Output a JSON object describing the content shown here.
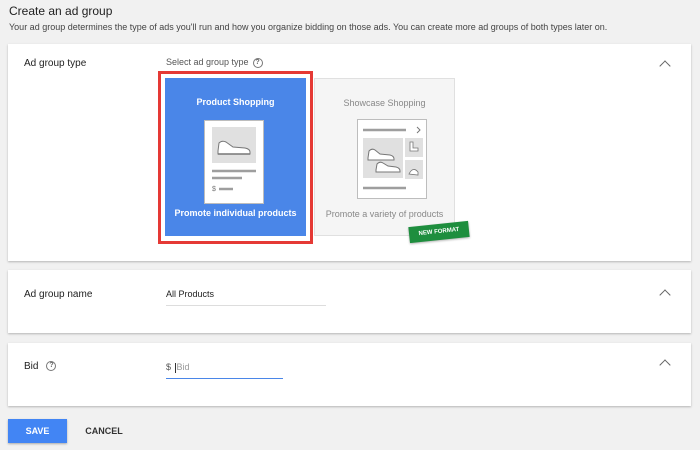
{
  "header": {
    "title": "Create an ad group",
    "subtitle": "Your ad group determines the type of ads you'll run and how you organize bidding on those ads. You can create more ad groups of both types later on."
  },
  "ad_group_type": {
    "label": "Ad group type",
    "select_label": "Select ad group type",
    "options": [
      {
        "title": "Product Shopping",
        "description": "Promote individual products",
        "selected": true
      },
      {
        "title": "Showcase Shopping",
        "description": "Promote a variety of products",
        "badge": "NEW FORMAT",
        "selected": false
      }
    ],
    "price_symbol": "$"
  },
  "ad_group_name": {
    "label": "Ad group name",
    "value": "All Products"
  },
  "bid": {
    "label": "Bid",
    "currency": "$",
    "placeholder": "Bid"
  },
  "help_glyph": "?",
  "actions": {
    "save_label": "SAVE",
    "cancel_label": "CANCEL"
  },
  "colors": {
    "accent": "#4a86e8",
    "highlight": "#e53935",
    "badge": "#1e8e3e"
  }
}
